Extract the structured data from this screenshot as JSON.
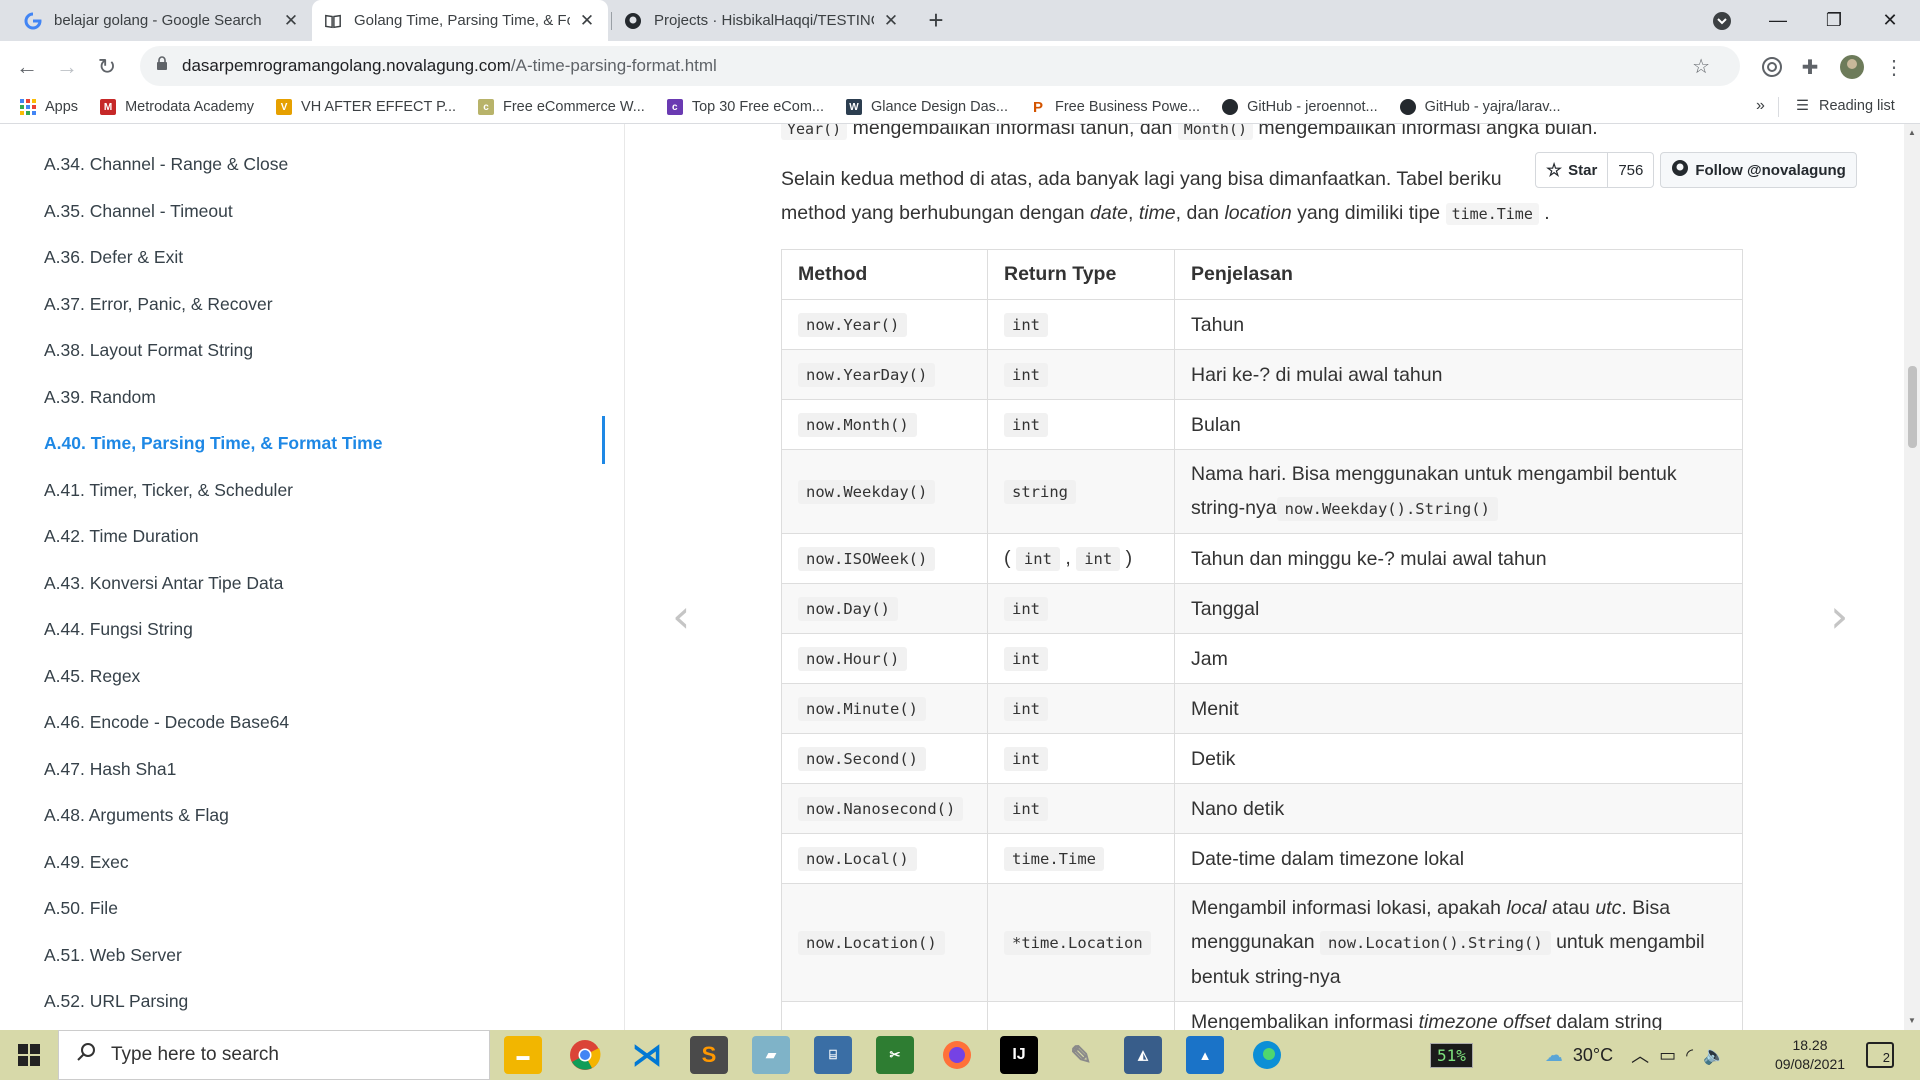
{
  "browser": {
    "tabs": [
      {
        "title": "belajar golang - Google Search",
        "icon": "google-icon"
      },
      {
        "title": "Golang Time, Parsing Time, & For",
        "icon": "book-icon"
      },
      {
        "title": "Projects · HisbikalHaqqi/TESTING",
        "icon": "github-icon"
      }
    ],
    "url_host": "dasarpemrogramangolang.novalagung.com",
    "url_path": "/A-time-parsing-format.html",
    "bookmarks": [
      {
        "label": "Apps",
        "icon": "apps-grid-icon",
        "color": "#4285f4"
      },
      {
        "label": "Metrodata Academy",
        "icon": "metrodata-icon",
        "color": "#c62828"
      },
      {
        "label": "VH AFTER EFFECT P...",
        "icon": "vh-icon",
        "color": "#e6a000"
      },
      {
        "label": "Free eCommerce W...",
        "icon": "colorlib-icon",
        "color": "#b8b36a"
      },
      {
        "label": "Top 30 Free eCom...",
        "icon": "colorlib-icon",
        "color": "#6a3ab2"
      },
      {
        "label": "Glance Design Das...",
        "icon": "w3-icon",
        "color": "#2c3e50"
      },
      {
        "label": "Free Business Powe...",
        "icon": "p-icon",
        "color": "#d35400"
      },
      {
        "label": "GitHub - jeroennot...",
        "icon": "github-icon",
        "color": "#24292e"
      },
      {
        "label": "GitHub - yajra/larav...",
        "icon": "github-icon",
        "color": "#24292e"
      }
    ],
    "more_bookmarks": "»",
    "reading_list": "Reading list"
  },
  "sidebar": {
    "items": [
      "A.34. Channel - Range & Close",
      "A.35. Channel - Timeout",
      "A.36. Defer & Exit",
      "A.37. Error, Panic, & Recover",
      "A.38. Layout Format String",
      "A.39. Random",
      "A.40. Time, Parsing Time, & Format Time",
      "A.41. Timer, Ticker, & Scheduler",
      "A.42. Time Duration",
      "A.43. Konversi Antar Tipe Data",
      "A.44. Fungsi String",
      "A.45. Regex",
      "A.46. Encode - Decode Base64",
      "A.47. Hash Sha1",
      "A.48. Arguments & Flag",
      "A.49. Exec",
      "A.50. File",
      "A.51. Web Server",
      "A.52. URL Parsing"
    ],
    "active_index": 6
  },
  "content": {
    "top_line": {
      "code1": "Year()",
      "text1": " mengembalikan informasi tahun, dan ",
      "code2": "Month()",
      "text2": " mengembalikan informasi angka bulan."
    },
    "para_line1": "Selain kedua method di atas, ada banyak lagi yang bisa dimanfaatkan. Tabel beriku",
    "para_line2": {
      "t1": "method yang berhubungan dengan ",
      "e1": "date",
      "t2": ", ",
      "e2": "time",
      "t3": ", dan ",
      "e3": "location",
      "t4": " yang dimiliki tipe ",
      "code": "time.Time",
      "t5": " ."
    },
    "github": {
      "star_label": "Star",
      "star_count": "756",
      "follow_label": "Follow @novalagung"
    },
    "table": {
      "headers": [
        "Method",
        "Return Type",
        "Penjelasan"
      ],
      "rows": [
        {
          "method": "now.Year()",
          "type": "int",
          "desc": "Tahun"
        },
        {
          "method": "now.YearDay()",
          "type": "int",
          "desc": "Hari ke-? di mulai awal tahun"
        },
        {
          "method": "now.Month()",
          "type": "int",
          "desc": "Bulan"
        },
        {
          "method": "now.Weekday()",
          "type": "string",
          "desc_a": "Nama hari. Bisa menggunakan ",
          "desc_code": "now.Weekday().String()",
          "desc_b": "untuk mengambil bentuk string-nya"
        },
        {
          "method": "now.ISOWeek()",
          "type_a": "( ",
          "type_code1": "int",
          "type_sep": " , ",
          "type_code2": "int",
          "type_b": " )",
          "desc": "Tahun dan minggu ke-? mulai awal tahun"
        },
        {
          "method": "now.Day()",
          "type": "int",
          "desc": "Tanggal"
        },
        {
          "method": "now.Hour()",
          "type": "int",
          "desc": "Jam"
        },
        {
          "method": "now.Minute()",
          "type": "int",
          "desc": "Menit"
        },
        {
          "method": "now.Second()",
          "type": "int",
          "desc": "Detik"
        },
        {
          "method": "now.Nanosecond()",
          "type": "int",
          "desc": "Nano detik"
        },
        {
          "method": "now.Local()",
          "type": "time.Time",
          "desc": "Date-time dalam timezone lokal"
        },
        {
          "method": "now.Location()",
          "type": "*time.Location",
          "desc_a": "Mengambil informasi lokasi, apakah ",
          "desc_e1": "local",
          "desc_m": " atau ",
          "desc_e2": "utc",
          "desc_b": ". Bisa menggunakan ",
          "desc_code": "now.Location().String()",
          "desc_c": " untuk mengambil bentuk string-nya"
        },
        {
          "desc_a": "Mengembalikan informasi ",
          "desc_e1": "timezone offset",
          "desc_b": " dalam string"
        }
      ]
    },
    "nav_prev": "‹",
    "nav_next": "›"
  },
  "taskbar": {
    "search_placeholder": "Type here to search",
    "battery": "51%",
    "weather": "30°C",
    "time": "18.28",
    "date": "09/08/2021",
    "notifications": "2"
  }
}
